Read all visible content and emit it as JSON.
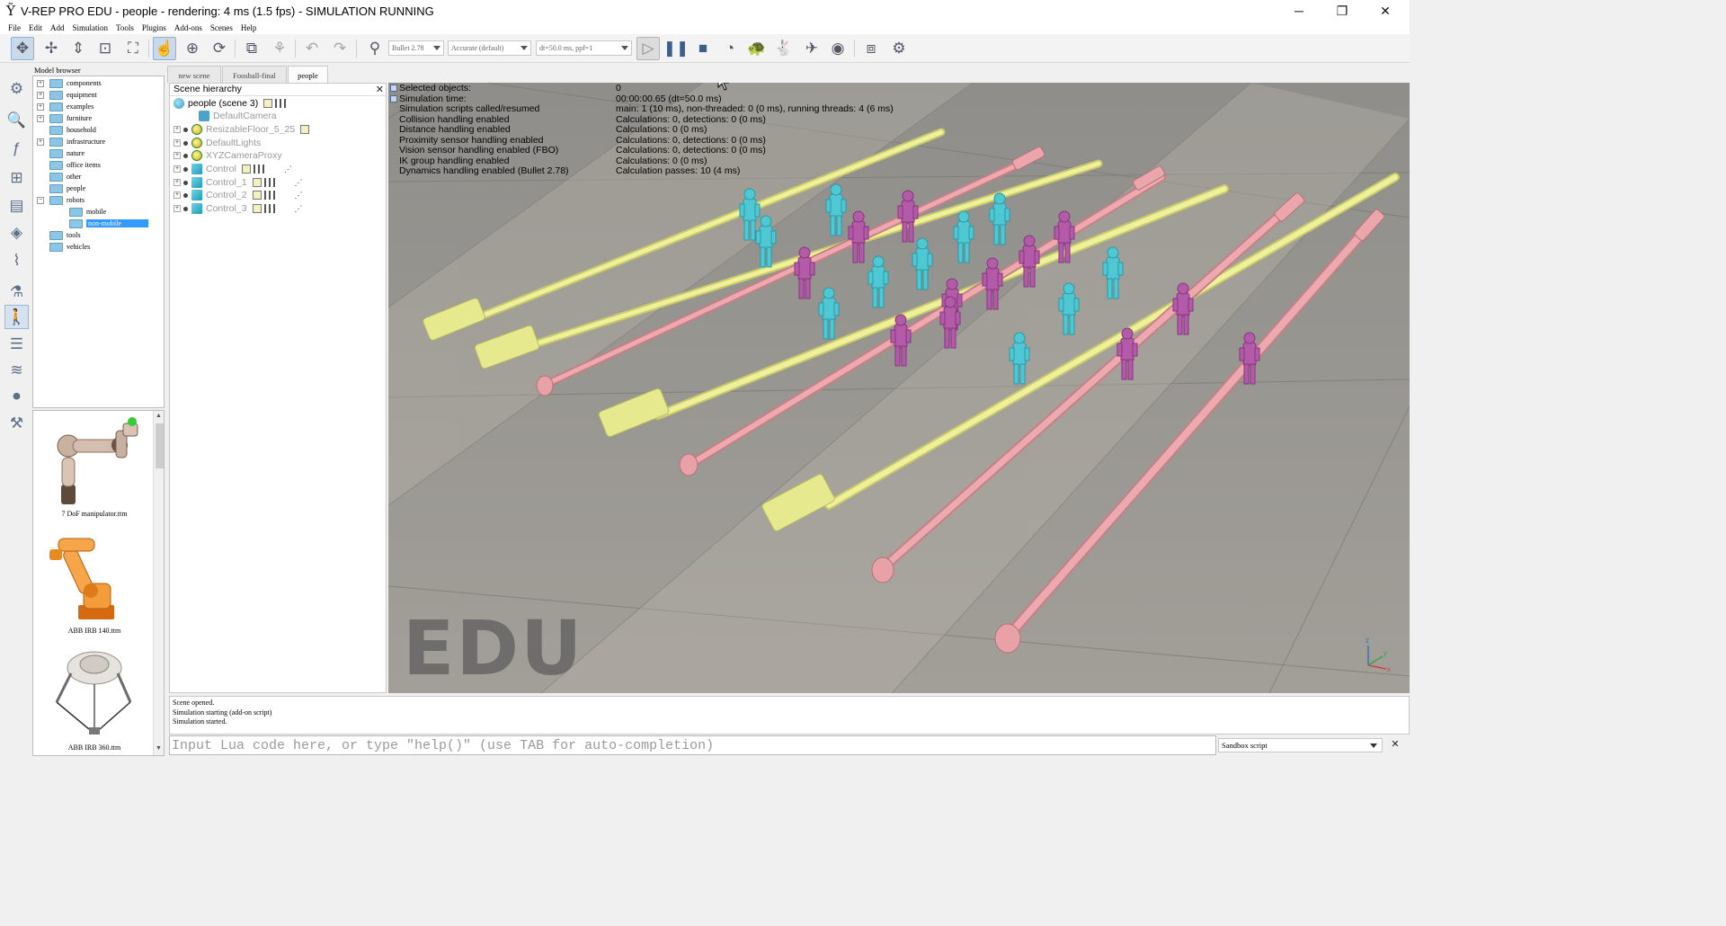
{
  "window": {
    "title": "V-REP PRO EDU - people - rendering: 4 ms (1.5 fps) - SIMULATION RUNNING",
    "app_icon": "vrep-logo-icon",
    "minimize": "─",
    "maximize": "❐",
    "close": "✕"
  },
  "menu": [
    "File",
    "Edit",
    "Add",
    "Simulation",
    "Tools",
    "Plugins",
    "Add-ons",
    "Scenes",
    "Help"
  ],
  "toolbar": {
    "engine": "Bullet 2.78",
    "accuracy": "Accurate (default)",
    "timestep": "dt=50.0 ms, ppf=1"
  },
  "model_browser": {
    "title": "Model browser",
    "items": [
      {
        "label": "components",
        "exp": "+"
      },
      {
        "label": "equipment",
        "exp": "+"
      },
      {
        "label": "examples",
        "exp": "+"
      },
      {
        "label": "furniture",
        "exp": "+"
      },
      {
        "label": "household",
        "exp": ""
      },
      {
        "label": "infrastructure",
        "exp": "+"
      },
      {
        "label": "nature",
        "exp": ""
      },
      {
        "label": "office items",
        "exp": ""
      },
      {
        "label": "other",
        "exp": ""
      },
      {
        "label": "people",
        "exp": ""
      },
      {
        "label": "robots",
        "exp": "−"
      },
      {
        "label": "mobile",
        "exp": ""
      },
      {
        "label": "non-mobile",
        "exp": ""
      },
      {
        "label": "tools",
        "exp": ""
      },
      {
        "label": "vehicles",
        "exp": ""
      }
    ],
    "thumbnails": [
      {
        "caption": "7 DoF manipulator.ttm"
      },
      {
        "caption": "ABB IRB 140.ttm"
      },
      {
        "caption": "ABB IRB 360.ttm"
      }
    ]
  },
  "scene_tabs": [
    "new scene",
    "Foosball-final",
    "people"
  ],
  "scene_hierarchy": {
    "title": "Scene hierarchy",
    "close": "✕",
    "root": "people (scene 3)",
    "items": [
      "DefaultCamera",
      "ResizableFloor_5_25",
      "DefaultLights",
      "XYZCameraProxy",
      "Control",
      "Control_1",
      "Control_2",
      "Control_3"
    ]
  },
  "info_panel": {
    "labels": [
      "Selected objects:",
      "Simulation time:",
      "Simulation scripts called/resumed",
      "Collision handling enabled",
      "Distance handling enabled",
      "Proximity sensor handling enabled",
      "Vision sensor handling enabled (FBO)",
      "IK group handling enabled",
      "Dynamics handling enabled (Bullet 2.78)"
    ],
    "values": [
      "0",
      "00:00:00.65 (dt=50.0 ms)",
      "main: 1 (10 ms), non-threaded: 0 (0 ms), running threads: 4 (6 ms)",
      "Calculations: 0, detections: 0 (0 ms)",
      "Calculations: 0 (0 ms)",
      "Calculations: 0, detections: 0 (0 ms)",
      "Calculations: 0, detections: 0 (0 ms)",
      "Calculations: 0 (0 ms)",
      "Calculation passes: 10 (4 ms)"
    ]
  },
  "viewport": {
    "watermark": "EDU",
    "axis_x": "x",
    "axis_y": "y",
    "axis_z": "z",
    "colors": {
      "rod_yellow": "#e6e88a",
      "rod_pink": "#e49aa0",
      "player_cyan": "#4fc8d4",
      "player_magenta": "#b35aa8"
    }
  },
  "console": {
    "lines": [
      "Scene opened.",
      "Simulation starting (add-on script)",
      "Simulation started."
    ],
    "placeholder": "Input Lua code here, or type \"help()\" (use TAB for auto-completion)",
    "script_select": "Sandbox script",
    "close": "✕"
  }
}
